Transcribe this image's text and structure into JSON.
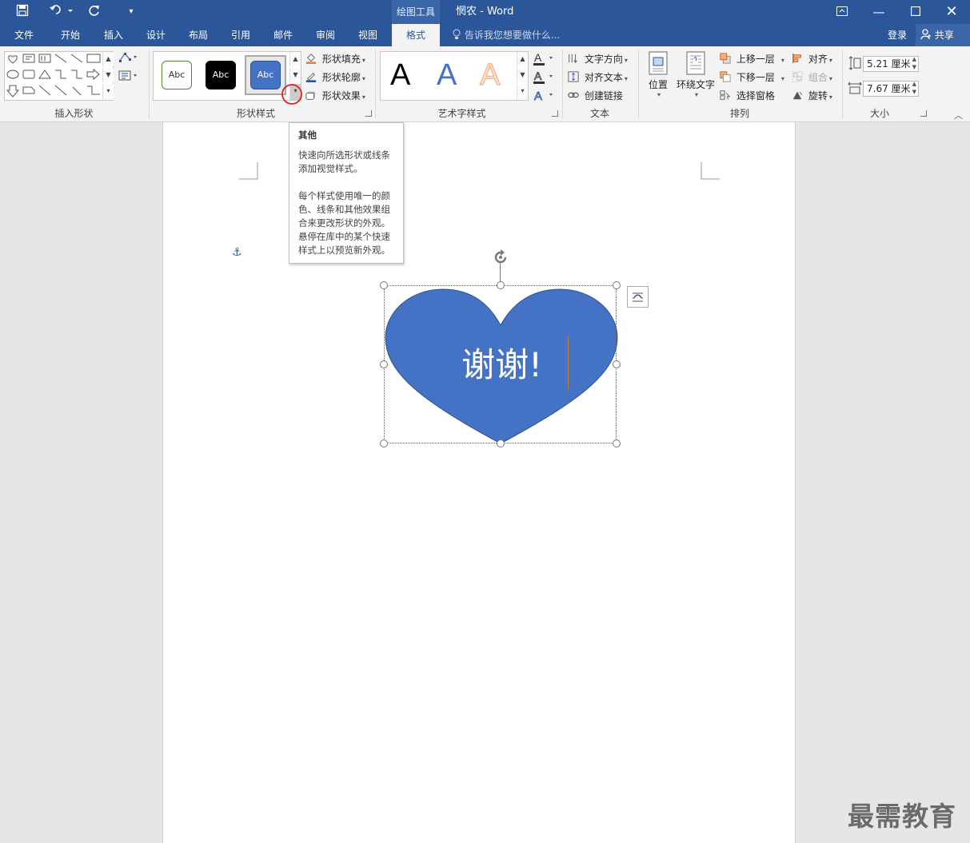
{
  "window": {
    "title": "惘农 - Word",
    "context_tool": "绘图工具"
  },
  "quick_access": {
    "save_icon": "save-icon",
    "undo_icon": "undo-icon",
    "redo_icon": "redo-icon",
    "customize_icon": "customize-qat-icon"
  },
  "window_controls": {
    "ribbon_display_icon": "ribbon-display-icon",
    "minimize_icon": "minimize-icon",
    "maximize_icon": "maximize-icon",
    "close_icon": "close-icon"
  },
  "tabs": [
    "文件",
    "开始",
    "插入",
    "设计",
    "布局",
    "引用",
    "邮件",
    "审阅",
    "视图",
    "格式"
  ],
  "active_tab": "格式",
  "tell_me": "告诉我您想要做什么...",
  "account": {
    "signin": "登录",
    "share": "共享"
  },
  "ribbon": {
    "insert_shapes": {
      "label": "插入形状"
    },
    "shape_styles": {
      "label": "形状样式",
      "presets": [
        "Abc",
        "Abc",
        "Abc"
      ],
      "fill": "形状填充",
      "outline": "形状轮廓",
      "effects": "形状效果"
    },
    "wordart": {
      "label": "艺术字样式",
      "letters": [
        "A",
        "A",
        "A"
      ]
    },
    "text": {
      "label": "文本",
      "direction": "文字方向",
      "align": "对齐文本",
      "link": "创建链接"
    },
    "arrange": {
      "label": "排列",
      "position": "位置",
      "wrap": "环绕文字",
      "forward": "上移一层",
      "backward": "下移一层",
      "pane": "选择窗格",
      "align": "对齐",
      "group": "组合",
      "rotate": "旋转"
    },
    "size": {
      "label": "大小",
      "height": "5.21 厘米",
      "width": "7.67 厘米"
    }
  },
  "tooltip": {
    "title": "其他",
    "line1": "快速向所选形状或线条添加视觉样式。",
    "line2": "每个样式使用唯一的颜色、线条和其他效果组合来更改形状的外观。",
    "line3": "悬停在库中的某个快速样式上以预览新外观。"
  },
  "document": {
    "shape_text": "谢谢!",
    "shape_fill": "#4472c4",
    "shape_kind": "heart"
  },
  "colors": {
    "brand": "#2b579a",
    "shape_fill": "#4472c4",
    "wordart_outline": "#f4b183",
    "highlight": "#e02020"
  },
  "watermark": "最需教育"
}
